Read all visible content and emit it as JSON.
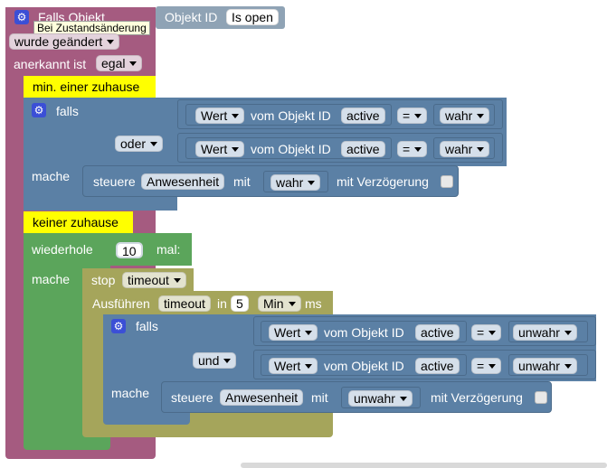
{
  "trigger": {
    "title": "Falls Objekt",
    "tooltip": "Bei Zustandsänderung",
    "changed": "wurde geändert",
    "ack_label": "anerkannt ist",
    "ack_value": "egal",
    "objid_label": "Objekt ID",
    "objid_value": "Is open"
  },
  "comment1": "min. einer zuhause",
  "if1": {
    "falls": "falls",
    "oder": "oder",
    "mache": "mache",
    "cond1": {
      "wert": "Wert",
      "vom": "vom Objekt ID",
      "obj": "active",
      "op": "=",
      "val": "wahr"
    },
    "cond2": {
      "wert": "Wert",
      "vom": "vom Objekt ID",
      "obj": "active",
      "op": "=",
      "val": "wahr"
    },
    "set": {
      "steuere": "steuere",
      "name": "Anwesenheit",
      "mit": "mit",
      "val": "wahr",
      "delay": "mit Verzögerung"
    }
  },
  "comment2": "keiner zuhause",
  "repeat": {
    "label": "wiederhole",
    "count": "10",
    "suffix": "mal:",
    "mache": "mache",
    "stop_label": "stop",
    "stop_name": "timeout",
    "exec_label": "Ausführen",
    "exec_name": "timeout",
    "exec_in": "in",
    "exec_num": "5",
    "exec_unit": "Min",
    "exec_ms": "ms"
  },
  "if2": {
    "falls": "falls",
    "und": "und",
    "mache": "mache",
    "cond1": {
      "wert": "Wert",
      "vom": "vom Objekt ID",
      "obj": "active",
      "op": "=",
      "val": "unwahr"
    },
    "cond2": {
      "wert": "Wert",
      "vom": "vom Objekt ID",
      "obj": "active",
      "op": "=",
      "val": "unwahr"
    },
    "set": {
      "steuere": "steuere",
      "name": "Anwesenheit",
      "mit": "mit",
      "val": "unwahr",
      "delay": "mit Verzögerung"
    }
  },
  "colors": {
    "trigger": "#a55b80",
    "logic": "#5b80a5",
    "loop": "#5ba55b",
    "timeout": "#a5a55b",
    "comment": "#ffff00",
    "field": "#dde6ee"
  }
}
